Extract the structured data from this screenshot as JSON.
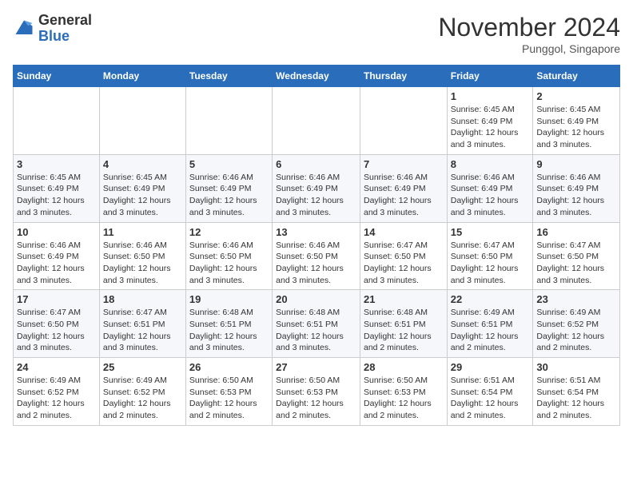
{
  "header": {
    "logo_line1": "General",
    "logo_line2": "Blue",
    "month_title": "November 2024",
    "location": "Punggol, Singapore"
  },
  "days_of_week": [
    "Sunday",
    "Monday",
    "Tuesday",
    "Wednesday",
    "Thursday",
    "Friday",
    "Saturday"
  ],
  "weeks": [
    [
      {
        "day": "",
        "info": ""
      },
      {
        "day": "",
        "info": ""
      },
      {
        "day": "",
        "info": ""
      },
      {
        "day": "",
        "info": ""
      },
      {
        "day": "",
        "info": ""
      },
      {
        "day": "1",
        "info": "Sunrise: 6:45 AM\nSunset: 6:49 PM\nDaylight: 12 hours and 3 minutes."
      },
      {
        "day": "2",
        "info": "Sunrise: 6:45 AM\nSunset: 6:49 PM\nDaylight: 12 hours and 3 minutes."
      }
    ],
    [
      {
        "day": "3",
        "info": "Sunrise: 6:45 AM\nSunset: 6:49 PM\nDaylight: 12 hours and 3 minutes."
      },
      {
        "day": "4",
        "info": "Sunrise: 6:45 AM\nSunset: 6:49 PM\nDaylight: 12 hours and 3 minutes."
      },
      {
        "day": "5",
        "info": "Sunrise: 6:46 AM\nSunset: 6:49 PM\nDaylight: 12 hours and 3 minutes."
      },
      {
        "day": "6",
        "info": "Sunrise: 6:46 AM\nSunset: 6:49 PM\nDaylight: 12 hours and 3 minutes."
      },
      {
        "day": "7",
        "info": "Sunrise: 6:46 AM\nSunset: 6:49 PM\nDaylight: 12 hours and 3 minutes."
      },
      {
        "day": "8",
        "info": "Sunrise: 6:46 AM\nSunset: 6:49 PM\nDaylight: 12 hours and 3 minutes."
      },
      {
        "day": "9",
        "info": "Sunrise: 6:46 AM\nSunset: 6:49 PM\nDaylight: 12 hours and 3 minutes."
      }
    ],
    [
      {
        "day": "10",
        "info": "Sunrise: 6:46 AM\nSunset: 6:49 PM\nDaylight: 12 hours and 3 minutes."
      },
      {
        "day": "11",
        "info": "Sunrise: 6:46 AM\nSunset: 6:50 PM\nDaylight: 12 hours and 3 minutes."
      },
      {
        "day": "12",
        "info": "Sunrise: 6:46 AM\nSunset: 6:50 PM\nDaylight: 12 hours and 3 minutes."
      },
      {
        "day": "13",
        "info": "Sunrise: 6:46 AM\nSunset: 6:50 PM\nDaylight: 12 hours and 3 minutes."
      },
      {
        "day": "14",
        "info": "Sunrise: 6:47 AM\nSunset: 6:50 PM\nDaylight: 12 hours and 3 minutes."
      },
      {
        "day": "15",
        "info": "Sunrise: 6:47 AM\nSunset: 6:50 PM\nDaylight: 12 hours and 3 minutes."
      },
      {
        "day": "16",
        "info": "Sunrise: 6:47 AM\nSunset: 6:50 PM\nDaylight: 12 hours and 3 minutes."
      }
    ],
    [
      {
        "day": "17",
        "info": "Sunrise: 6:47 AM\nSunset: 6:50 PM\nDaylight: 12 hours and 3 minutes."
      },
      {
        "day": "18",
        "info": "Sunrise: 6:47 AM\nSunset: 6:51 PM\nDaylight: 12 hours and 3 minutes."
      },
      {
        "day": "19",
        "info": "Sunrise: 6:48 AM\nSunset: 6:51 PM\nDaylight: 12 hours and 3 minutes."
      },
      {
        "day": "20",
        "info": "Sunrise: 6:48 AM\nSunset: 6:51 PM\nDaylight: 12 hours and 3 minutes."
      },
      {
        "day": "21",
        "info": "Sunrise: 6:48 AM\nSunset: 6:51 PM\nDaylight: 12 hours and 2 minutes."
      },
      {
        "day": "22",
        "info": "Sunrise: 6:49 AM\nSunset: 6:51 PM\nDaylight: 12 hours and 2 minutes."
      },
      {
        "day": "23",
        "info": "Sunrise: 6:49 AM\nSunset: 6:52 PM\nDaylight: 12 hours and 2 minutes."
      }
    ],
    [
      {
        "day": "24",
        "info": "Sunrise: 6:49 AM\nSunset: 6:52 PM\nDaylight: 12 hours and 2 minutes."
      },
      {
        "day": "25",
        "info": "Sunrise: 6:49 AM\nSunset: 6:52 PM\nDaylight: 12 hours and 2 minutes."
      },
      {
        "day": "26",
        "info": "Sunrise: 6:50 AM\nSunset: 6:53 PM\nDaylight: 12 hours and 2 minutes."
      },
      {
        "day": "27",
        "info": "Sunrise: 6:50 AM\nSunset: 6:53 PM\nDaylight: 12 hours and 2 minutes."
      },
      {
        "day": "28",
        "info": "Sunrise: 6:50 AM\nSunset: 6:53 PM\nDaylight: 12 hours and 2 minutes."
      },
      {
        "day": "29",
        "info": "Sunrise: 6:51 AM\nSunset: 6:54 PM\nDaylight: 12 hours and 2 minutes."
      },
      {
        "day": "30",
        "info": "Sunrise: 6:51 AM\nSunset: 6:54 PM\nDaylight: 12 hours and 2 minutes."
      }
    ]
  ]
}
